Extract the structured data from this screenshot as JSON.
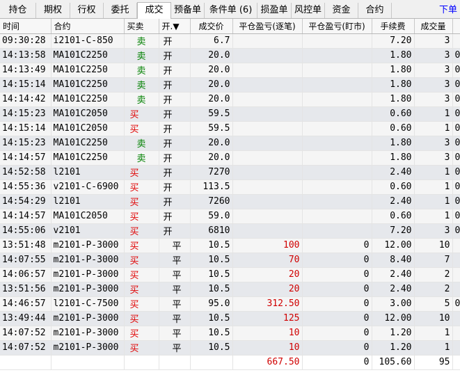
{
  "tabs": [
    "持仓",
    "期权",
    "行权",
    "委托",
    "成交",
    "预备单",
    "条件单 (6)",
    "损盈单",
    "风控单",
    "资金",
    "合约"
  ],
  "active_tab": "成交",
  "order_button": "下单",
  "columns": [
    "时间",
    "合约",
    "买卖",
    "开.▼",
    "成交价",
    "平仓盈亏(逐笔)",
    "平仓盈亏(盯市)",
    "手续费",
    "成交量",
    ""
  ],
  "rows": [
    {
      "time": "09:30:28",
      "contract": "i2101-C-850",
      "side": "卖",
      "oc": "开",
      "price": "6.7",
      "pnl1": "",
      "pnl2": "",
      "fee": "7.20",
      "vol": "3",
      "extra": ""
    },
    {
      "time": "14:13:58",
      "contract": "MA101C2250",
      "side": "卖",
      "oc": "开",
      "price": "20.0",
      "pnl1": "",
      "pnl2": "",
      "fee": "1.80",
      "vol": "3",
      "extra": "0"
    },
    {
      "time": "14:13:49",
      "contract": "MA101C2250",
      "side": "卖",
      "oc": "开",
      "price": "20.0",
      "pnl1": "",
      "pnl2": "",
      "fee": "1.80",
      "vol": "3",
      "extra": "0"
    },
    {
      "time": "14:15:14",
      "contract": "MA101C2250",
      "side": "卖",
      "oc": "开",
      "price": "20.0",
      "pnl1": "",
      "pnl2": "",
      "fee": "1.80",
      "vol": "3",
      "extra": "0"
    },
    {
      "time": "14:14:42",
      "contract": "MA101C2250",
      "side": "卖",
      "oc": "开",
      "price": "20.0",
      "pnl1": "",
      "pnl2": "",
      "fee": "1.80",
      "vol": "3",
      "extra": "0"
    },
    {
      "time": "14:15:23",
      "contract": "MA101C2050",
      "side": "买",
      "oc": "开",
      "price": "59.5",
      "pnl1": "",
      "pnl2": "",
      "fee": "0.60",
      "vol": "1",
      "extra": "0"
    },
    {
      "time": "14:15:14",
      "contract": "MA101C2050",
      "side": "买",
      "oc": "开",
      "price": "59.5",
      "pnl1": "",
      "pnl2": "",
      "fee": "0.60",
      "vol": "1",
      "extra": "0"
    },
    {
      "time": "14:15:23",
      "contract": "MA101C2250",
      "side": "卖",
      "oc": "开",
      "price": "20.0",
      "pnl1": "",
      "pnl2": "",
      "fee": "1.80",
      "vol": "3",
      "extra": "0"
    },
    {
      "time": "14:14:57",
      "contract": "MA101C2250",
      "side": "卖",
      "oc": "开",
      "price": "20.0",
      "pnl1": "",
      "pnl2": "",
      "fee": "1.80",
      "vol": "3",
      "extra": "0"
    },
    {
      "time": "14:52:58",
      "contract": "l2101",
      "side": "买",
      "oc": "开",
      "price": "7270",
      "pnl1": "",
      "pnl2": "",
      "fee": "2.40",
      "vol": "1",
      "extra": "0"
    },
    {
      "time": "14:55:36",
      "contract": "v2101-C-6900",
      "side": "买",
      "oc": "开",
      "price": "113.5",
      "pnl1": "",
      "pnl2": "",
      "fee": "0.60",
      "vol": "1",
      "extra": "0"
    },
    {
      "time": "14:54:29",
      "contract": "l2101",
      "side": "买",
      "oc": "开",
      "price": "7260",
      "pnl1": "",
      "pnl2": "",
      "fee": "2.40",
      "vol": "1",
      "extra": "0"
    },
    {
      "time": "14:14:57",
      "contract": "MA101C2050",
      "side": "买",
      "oc": "开",
      "price": "59.0",
      "pnl1": "",
      "pnl2": "",
      "fee": "0.60",
      "vol": "1",
      "extra": "0"
    },
    {
      "time": "14:55:06",
      "contract": "v2101",
      "side": "买",
      "oc": "开",
      "price": "6810",
      "pnl1": "",
      "pnl2": "",
      "fee": "7.20",
      "vol": "3",
      "extra": "0"
    },
    {
      "time": "13:51:48",
      "contract": "m2101-P-3000",
      "side": "买",
      "oc": "平",
      "price": "10.5",
      "pnl1": "100",
      "pnl2": "0",
      "fee": "12.00",
      "vol": "10",
      "extra": ""
    },
    {
      "time": "14:07:55",
      "contract": "m2101-P-3000",
      "side": "买",
      "oc": "平",
      "price": "10.5",
      "pnl1": "70",
      "pnl2": "0",
      "fee": "8.40",
      "vol": "7",
      "extra": ""
    },
    {
      "time": "14:06:57",
      "contract": "m2101-P-3000",
      "side": "买",
      "oc": "平",
      "price": "10.5",
      "pnl1": "20",
      "pnl2": "0",
      "fee": "2.40",
      "vol": "2",
      "extra": ""
    },
    {
      "time": "13:51:56",
      "contract": "m2101-P-3000",
      "side": "买",
      "oc": "平",
      "price": "10.5",
      "pnl1": "20",
      "pnl2": "0",
      "fee": "2.40",
      "vol": "2",
      "extra": ""
    },
    {
      "time": "14:46:57",
      "contract": "l2101-C-7500",
      "side": "买",
      "oc": "平",
      "price": "95.0",
      "pnl1": "312.50",
      "pnl2": "0",
      "fee": "3.00",
      "vol": "5",
      "extra": "0"
    },
    {
      "time": "13:49:44",
      "contract": "m2101-P-3000",
      "side": "买",
      "oc": "平",
      "price": "10.5",
      "pnl1": "125",
      "pnl2": "0",
      "fee": "12.00",
      "vol": "10",
      "extra": ""
    },
    {
      "time": "14:07:52",
      "contract": "m2101-P-3000",
      "side": "买",
      "oc": "平",
      "price": "10.5",
      "pnl1": "10",
      "pnl2": "0",
      "fee": "1.20",
      "vol": "1",
      "extra": ""
    },
    {
      "time": "14:07:52",
      "contract": "m2101-P-3000",
      "side": "买",
      "oc": "平",
      "price": "10.5",
      "pnl1": "10",
      "pnl2": "0",
      "fee": "1.20",
      "vol": "1",
      "extra": ""
    }
  ],
  "totals": {
    "pnl1": "667.50",
    "pnl2": "0",
    "fee": "105.60",
    "vol": "95"
  },
  "colors": {
    "buy": "#e00000",
    "sell": "#008000",
    "profit": "#d00000",
    "link": "#0000ff"
  }
}
